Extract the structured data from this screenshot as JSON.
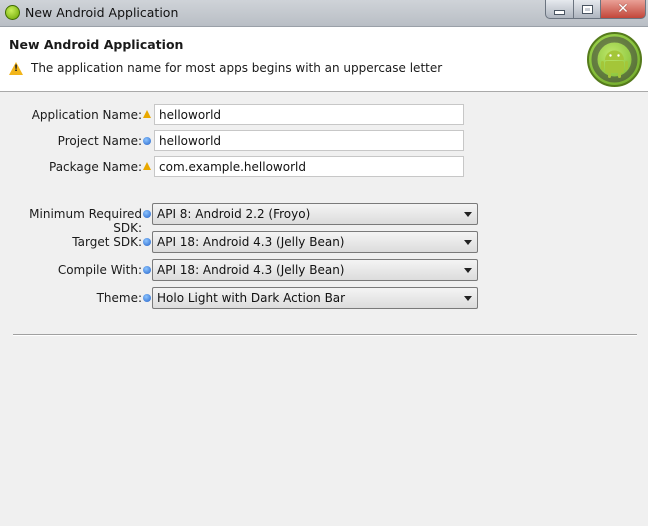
{
  "window": {
    "title": "New Android Application"
  },
  "header": {
    "title": "New Android Application",
    "message": "The application name for most apps begins with an uppercase letter"
  },
  "form": {
    "application_name": {
      "label": "Application Name:",
      "value": "helloworld",
      "marker": "warning"
    },
    "project_name": {
      "label": "Project Name:",
      "value": "helloworld",
      "marker": "info"
    },
    "package_name": {
      "label": "Package Name:",
      "value": "com.example.helloworld",
      "marker": "warning"
    },
    "min_sdk": {
      "label": "Minimum Required SDK:",
      "value": "API 8: Android 2.2 (Froyo)"
    },
    "target_sdk": {
      "label": "Target SDK:",
      "value": "API 18: Android 4.3 (Jelly Bean)"
    },
    "compile_with": {
      "label": "Compile With:",
      "value": "API 18: Android 4.3 (Jelly Bean)"
    },
    "theme": {
      "label": "Theme:",
      "value": "Holo Light with Dark Action Bar"
    }
  },
  "colors": {
    "warning": "#f2b51a",
    "info": "#2563c9",
    "android_green": "#8cc63f"
  }
}
